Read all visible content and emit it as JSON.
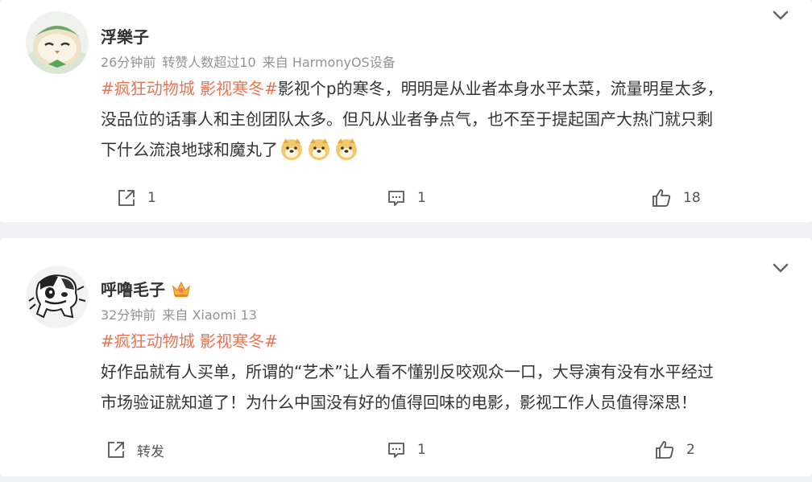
{
  "comments": [
    {
      "username": "浮樂子",
      "meta": {
        "time": "26分钟前",
        "repost_info": "转赞人数超过10",
        "source": "来自 HarmonyOS设备"
      },
      "hashtag": "#疯狂动物城 影视寒冬#",
      "text_line1_rest": "影视个p的寒冬，明明是从业者本身水平太菜，流量明星太多，",
      "text_line2": "没品位的话事人和主创团队太多。但凡从业者争点气，也不至于提起国产大热门就只剩",
      "text_line3": "下什么流浪地球和魔丸了",
      "emoji_icons": [
        "doge-emoji",
        "doge-emoji",
        "doge-emoji"
      ],
      "actions": {
        "share": "1",
        "comment": "1",
        "like": "18"
      }
    },
    {
      "username": "呼噜毛子",
      "badge_icon": "crown-badge-icon",
      "meta": {
        "time": "32分钟前",
        "source": "来自 Xiaomi 13"
      },
      "hashtag": "#疯狂动物城 影视寒冬#",
      "text_line1": "好作品就有人买单，所谓的“艺术”让人看不懂别反咬观众一口，大导演有没有水平经过",
      "text_line2": "市场验证就知道了！为什么中国没有好的值得回味的电影，影视工作人员值得深思！",
      "actions": {
        "share": "转发",
        "comment": "1",
        "like": "2"
      }
    }
  ],
  "colors": {
    "tag": "#eb7350",
    "meta": "#939393",
    "background": "#f1f2f5"
  }
}
